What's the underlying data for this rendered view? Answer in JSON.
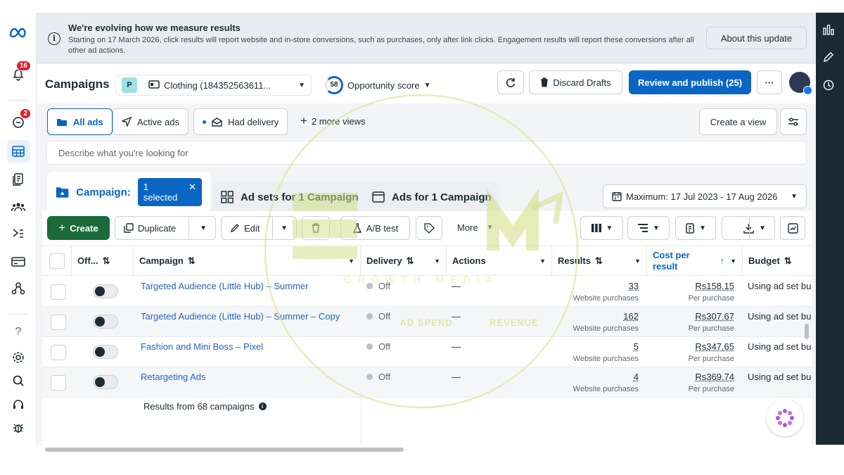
{
  "nav": {
    "notifications_badge": "16",
    "alerts_badge": "2"
  },
  "banner": {
    "title": "We're evolving how we measure results",
    "body": "Starting on 17 March 2026, click results will report website and in-store conversions, such as purchases, only after link clicks. Engagement results will report these conversions after all other ad actions.",
    "button": "About this update"
  },
  "header": {
    "title": "Campaigns",
    "account_initial": "P",
    "account_name": "Clothing (184352563611...",
    "opportunity_score": "58",
    "opportunity_label": "Opportunity score",
    "discard": "Discard Drafts",
    "review": "Review and publish (25)",
    "more": "···"
  },
  "views": {
    "all_ads": "All ads",
    "active_ads": "Active ads",
    "had_delivery": "Had delivery",
    "more_views": "2 more views",
    "create_view": "Create a view"
  },
  "search": {
    "placeholder": "Describe what you're looking for"
  },
  "levels": {
    "campaign": "Campaign:",
    "selected": "1 selected",
    "adsets": "Ad sets for 1 Campaign",
    "ads": "Ads for 1 Campaign",
    "date_range": "Maximum: 17 Jul 2023 - 17 Aug 2026"
  },
  "toolbar": {
    "create": "Create",
    "duplicate": "Duplicate",
    "edit": "Edit",
    "ab_test": "A/B test",
    "more": "More"
  },
  "table": {
    "headers": {
      "off": "Off...",
      "campaign": "Campaign",
      "delivery": "Delivery",
      "actions": "Actions",
      "results": "Results",
      "cost": "Cost per result",
      "budget": "Budget"
    },
    "rows": [
      {
        "name": "Targeted Audience (Little Hub) – Summer",
        "delivery": "Off",
        "actions": "—",
        "results": "33",
        "results_sub": "Website purchases",
        "cost": "Rs158.15",
        "cost_sub": "Per purchase",
        "budget": "Using ad set bu"
      },
      {
        "name": "Targeted Audience (Little Hub) – Summer – Copy",
        "delivery": "Off",
        "actions": "—",
        "results": "162",
        "results_sub": "Website purchases",
        "cost": "Rs307.67",
        "cost_sub": "Per purchase",
        "budget": "Using ad set bu"
      },
      {
        "name": "Fashion and Mini Boss – Pixel",
        "delivery": "Off",
        "actions": "—",
        "results": "5",
        "results_sub": "Website purchases",
        "cost": "Rs347.65",
        "cost_sub": "Per purchase",
        "budget": "Using ad set bu"
      },
      {
        "name": "Retargeting Ads",
        "delivery": "Off",
        "actions": "—",
        "results": "4",
        "results_sub": "Website purchases",
        "cost": "Rs369.74",
        "cost_sub": "Per purchase",
        "budget": "Using ad set bu"
      }
    ],
    "footer": "Results from 68 campaigns"
  },
  "watermark": {
    "line1": "GROWTH MEDIA",
    "line2": "AD SPEND",
    "line3": "REVENUE"
  },
  "colors": {
    "brand_blue": "#0a66c2",
    "create_green": "#1b6b3a",
    "badge_red": "#d8232a",
    "watermark": "#d4e08a"
  }
}
